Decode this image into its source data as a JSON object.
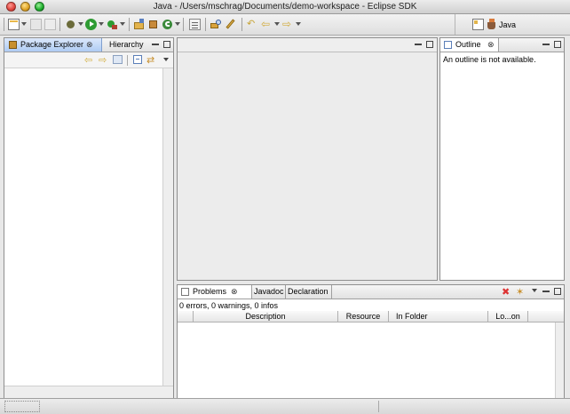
{
  "window": {
    "title": "Java - /Users/mschrag/Documents/demo-workspace - Eclipse SDK"
  },
  "toolbar": {
    "icons": [
      "new-wizard-icon",
      "save-icon",
      "print-icon",
      "debug-icon",
      "run-icon",
      "external-tools-icon",
      "new-java-project-icon",
      "new-package-icon",
      "new-class-icon",
      "open-type-icon",
      "search-icon",
      "pencil-icon",
      "last-edit-location-icon",
      "back-icon",
      "forward-icon"
    ],
    "perspective_label": "Java"
  },
  "package_explorer": {
    "tabs": [
      "Package Explorer",
      "Hierarchy"
    ]
  },
  "outline": {
    "tab_label": "Outline",
    "message": "An outline is not available."
  },
  "bottom": {
    "tabs": [
      "Problems",
      "Javadoc",
      "Declaration"
    ],
    "summary": "0 errors, 0 warnings, 0 infos",
    "columns": [
      "Description",
      "Resource",
      "In Folder",
      "Lo...on"
    ]
  },
  "colors": {
    "active_tab": "#aecbf3",
    "close_red": "#dd3333",
    "traffic_red": "#e0443e",
    "traffic_yellow": "#dea123",
    "traffic_green": "#1aab29"
  }
}
